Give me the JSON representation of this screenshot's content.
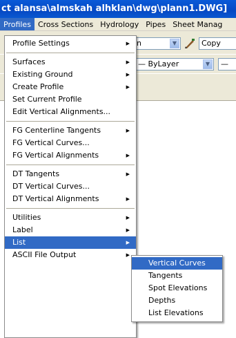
{
  "window": {
    "title": "ct alansa\\almskah alhklan\\dwg\\plann1.DWG]"
  },
  "menubar": {
    "items": [
      "Profiles",
      "Cross Sections",
      "Hydrology",
      "Pipes",
      "Sheet Manag"
    ],
    "active": "Profiles"
  },
  "toolbar": {
    "combo1_value": "n",
    "copy_label": "Copy",
    "layer_value": "— ByLayer",
    "combo3_value": "—"
  },
  "profiles_menu": {
    "groups": [
      [
        {
          "label": "Profile Settings",
          "submenu": true
        }
      ],
      [
        {
          "label": "Surfaces",
          "submenu": true
        },
        {
          "label": "Existing Ground",
          "submenu": true
        },
        {
          "label": "Create Profile",
          "submenu": true
        },
        {
          "label": "Set Current Profile",
          "submenu": false
        },
        {
          "label": "Edit Vertical Alignments...",
          "submenu": false
        }
      ],
      [
        {
          "label": "FG Centerline Tangents",
          "submenu": true
        },
        {
          "label": "FG Vertical Curves...",
          "submenu": false
        },
        {
          "label": "FG Vertical Alignments",
          "submenu": true
        }
      ],
      [
        {
          "label": "DT Tangents",
          "submenu": true
        },
        {
          "label": "DT Vertical Curves...",
          "submenu": false
        },
        {
          "label": "DT Vertical Alignments",
          "submenu": true
        }
      ],
      [
        {
          "label": "Utilities",
          "submenu": true
        },
        {
          "label": "Label",
          "submenu": true
        },
        {
          "label": "List",
          "submenu": true,
          "highlighted": true
        },
        {
          "label": "ASCII File Output",
          "submenu": true
        }
      ]
    ]
  },
  "list_submenu": {
    "items": [
      "Vertical Curves",
      "Tangents",
      "Spot Elevations",
      "Depths",
      "List Elevations"
    ],
    "highlighted": "Vertical Curves"
  },
  "colors": {
    "highlight": "#316ac5",
    "menubar_bg": "#ece9d8",
    "titlebar": "#0a5ad8"
  }
}
